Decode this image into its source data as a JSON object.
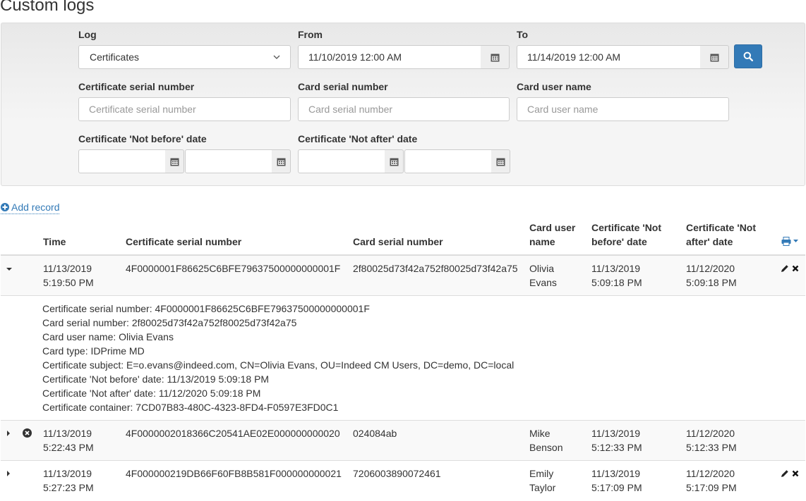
{
  "page": {
    "title": "Custom logs"
  },
  "filters": {
    "log_label": "Log",
    "log_value": "Certificates",
    "from_label": "From",
    "from_value": "11/10/2019 12:00 AM",
    "to_label": "To",
    "to_value": "11/14/2019 12:00 AM",
    "cert_serial_label": "Certificate serial number",
    "cert_serial_placeholder": "Certificate serial number",
    "card_serial_label": "Card serial number",
    "card_serial_placeholder": "Card serial number",
    "card_user_label": "Card user name",
    "card_user_placeholder": "Card user name",
    "not_before_label": "Certificate 'Not before' date",
    "not_after_label": "Certificate 'Not after' date"
  },
  "actions": {
    "add_record_label": "Add record"
  },
  "table": {
    "columns": {
      "time": "Time",
      "cert_serial": "Certificate serial number",
      "card_serial": "Card serial number",
      "card_user_1": "Card user",
      "card_user_2": "name",
      "not_before_1": "Certificate 'Not",
      "not_before_2": "before' date",
      "not_after_1": "Certificate 'Not",
      "not_after_2": "after' date"
    },
    "rows": [
      {
        "time_date": "11/13/2019",
        "time_clock": "5:19:50 PM",
        "cert_serial": "4F0000001F86625C6BFE79637500000000001F",
        "card_serial": "2f80025d73f42a752f80025d73f42a75",
        "user_first": "Olivia",
        "user_last": "Evans",
        "nb_date": "11/13/2019",
        "nb_time": "5:09:18 PM",
        "na_date": "11/12/2020",
        "na_time": "5:09:18 PM",
        "expanded": true,
        "details": [
          "Certificate serial number: 4F0000001F86625C6BFE79637500000000001F",
          "Card serial number: 2f80025d73f42a752f80025d73f42a75",
          "Card user name: Olivia Evans",
          "Card type: IDPrime MD",
          "Certificate subject: E=o.evans@indeed.com, CN=Olivia Evans, OU=Indeed CM Users, DC=demo, DC=local",
          "Certificate 'Not before' date: 11/13/2019 5:09:18 PM",
          "Certificate 'Not after' date: 11/12/2020 5:09:18 PM",
          "Certificate container: 7CD07B83-480C-4323-8FD4-F0597E3FD0C1"
        ]
      },
      {
        "time_date": "11/13/2019",
        "time_clock": "5:22:43 PM",
        "cert_serial": "4F0000002018366C20541AE02E000000000020",
        "card_serial": "024084ab",
        "user_first": "Mike",
        "user_last": "Benson",
        "nb_date": "11/13/2019",
        "nb_time": "5:12:33 PM",
        "na_date": "11/12/2020",
        "na_time": "5:12:33 PM",
        "expanded": false
      },
      {
        "time_date": "11/13/2019",
        "time_clock": "5:27:23 PM",
        "cert_serial": "4F000000219DB66F60FB8B581F000000000021",
        "card_serial": "7206003890072461",
        "user_first": "Emily",
        "user_last": "Taylor",
        "nb_date": "11/13/2019",
        "nb_time": "5:17:09 PM",
        "na_date": "11/12/2020",
        "na_time": "5:17:09 PM",
        "expanded": false
      }
    ]
  },
  "colors": {
    "accent": "#337ab7",
    "text": "#333333",
    "placeholder": "#999999"
  }
}
